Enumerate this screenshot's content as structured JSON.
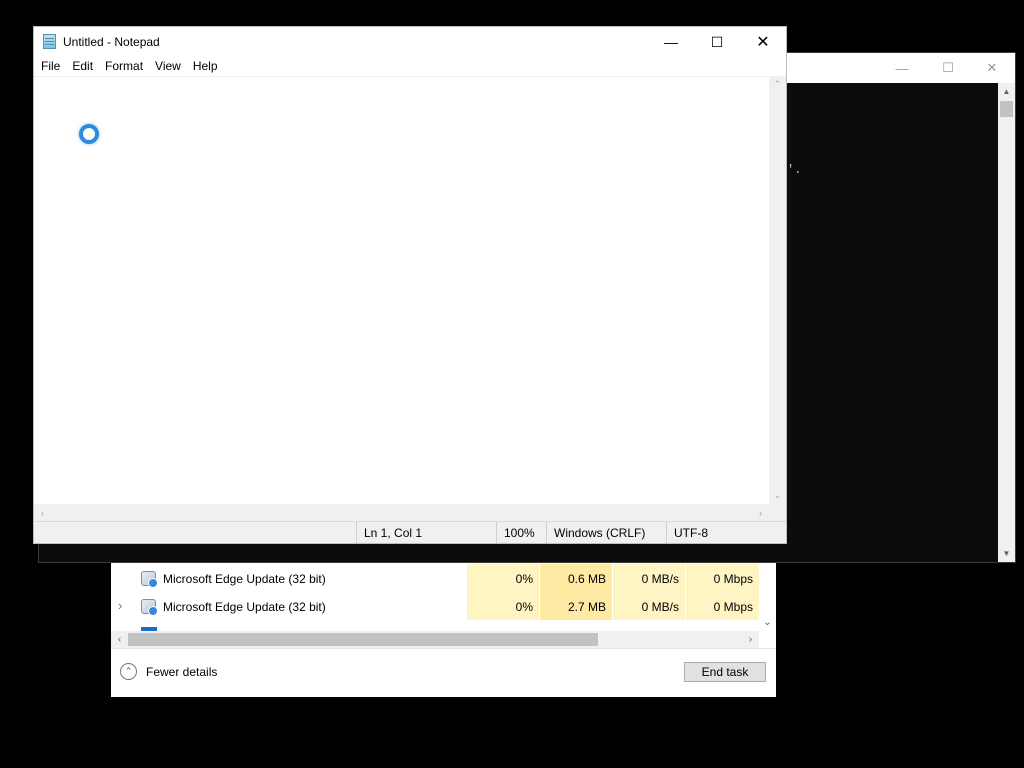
{
  "console": {
    "text": "'."
  },
  "task_manager": {
    "rows": [
      {
        "name": "Microsoft Edge Update (32 bit)",
        "cpu": "0%",
        "memory": "0.6 MB",
        "disk": "0 MB/s",
        "network": "0 Mbps",
        "expandable": false
      },
      {
        "name": "Microsoft Edge Update (32 bit)",
        "cpu": "0%",
        "memory": "2.7 MB",
        "disk": "0 MB/s",
        "network": "0 Mbps",
        "expandable": true
      }
    ],
    "fewer_details_label": "Fewer details",
    "end_task_label": "End task"
  },
  "notepad": {
    "title": "Untitled - Notepad",
    "menu": [
      "File",
      "Edit",
      "Format",
      "View",
      "Help"
    ],
    "content": "",
    "status": {
      "position": "Ln 1, Col 1",
      "zoom": "100%",
      "line_ending": "Windows (CRLF)",
      "encoding": "UTF-8"
    }
  },
  "icons": {
    "minimize": "minimize-icon",
    "maximize": "maximize-icon",
    "close": "close-icon",
    "busy": "busy-spinner-icon"
  },
  "colors": {
    "cpu_heat": "#fff4c4",
    "memory_heat": "#ffeaa3",
    "busy_cursor": "#2d8ae0"
  }
}
